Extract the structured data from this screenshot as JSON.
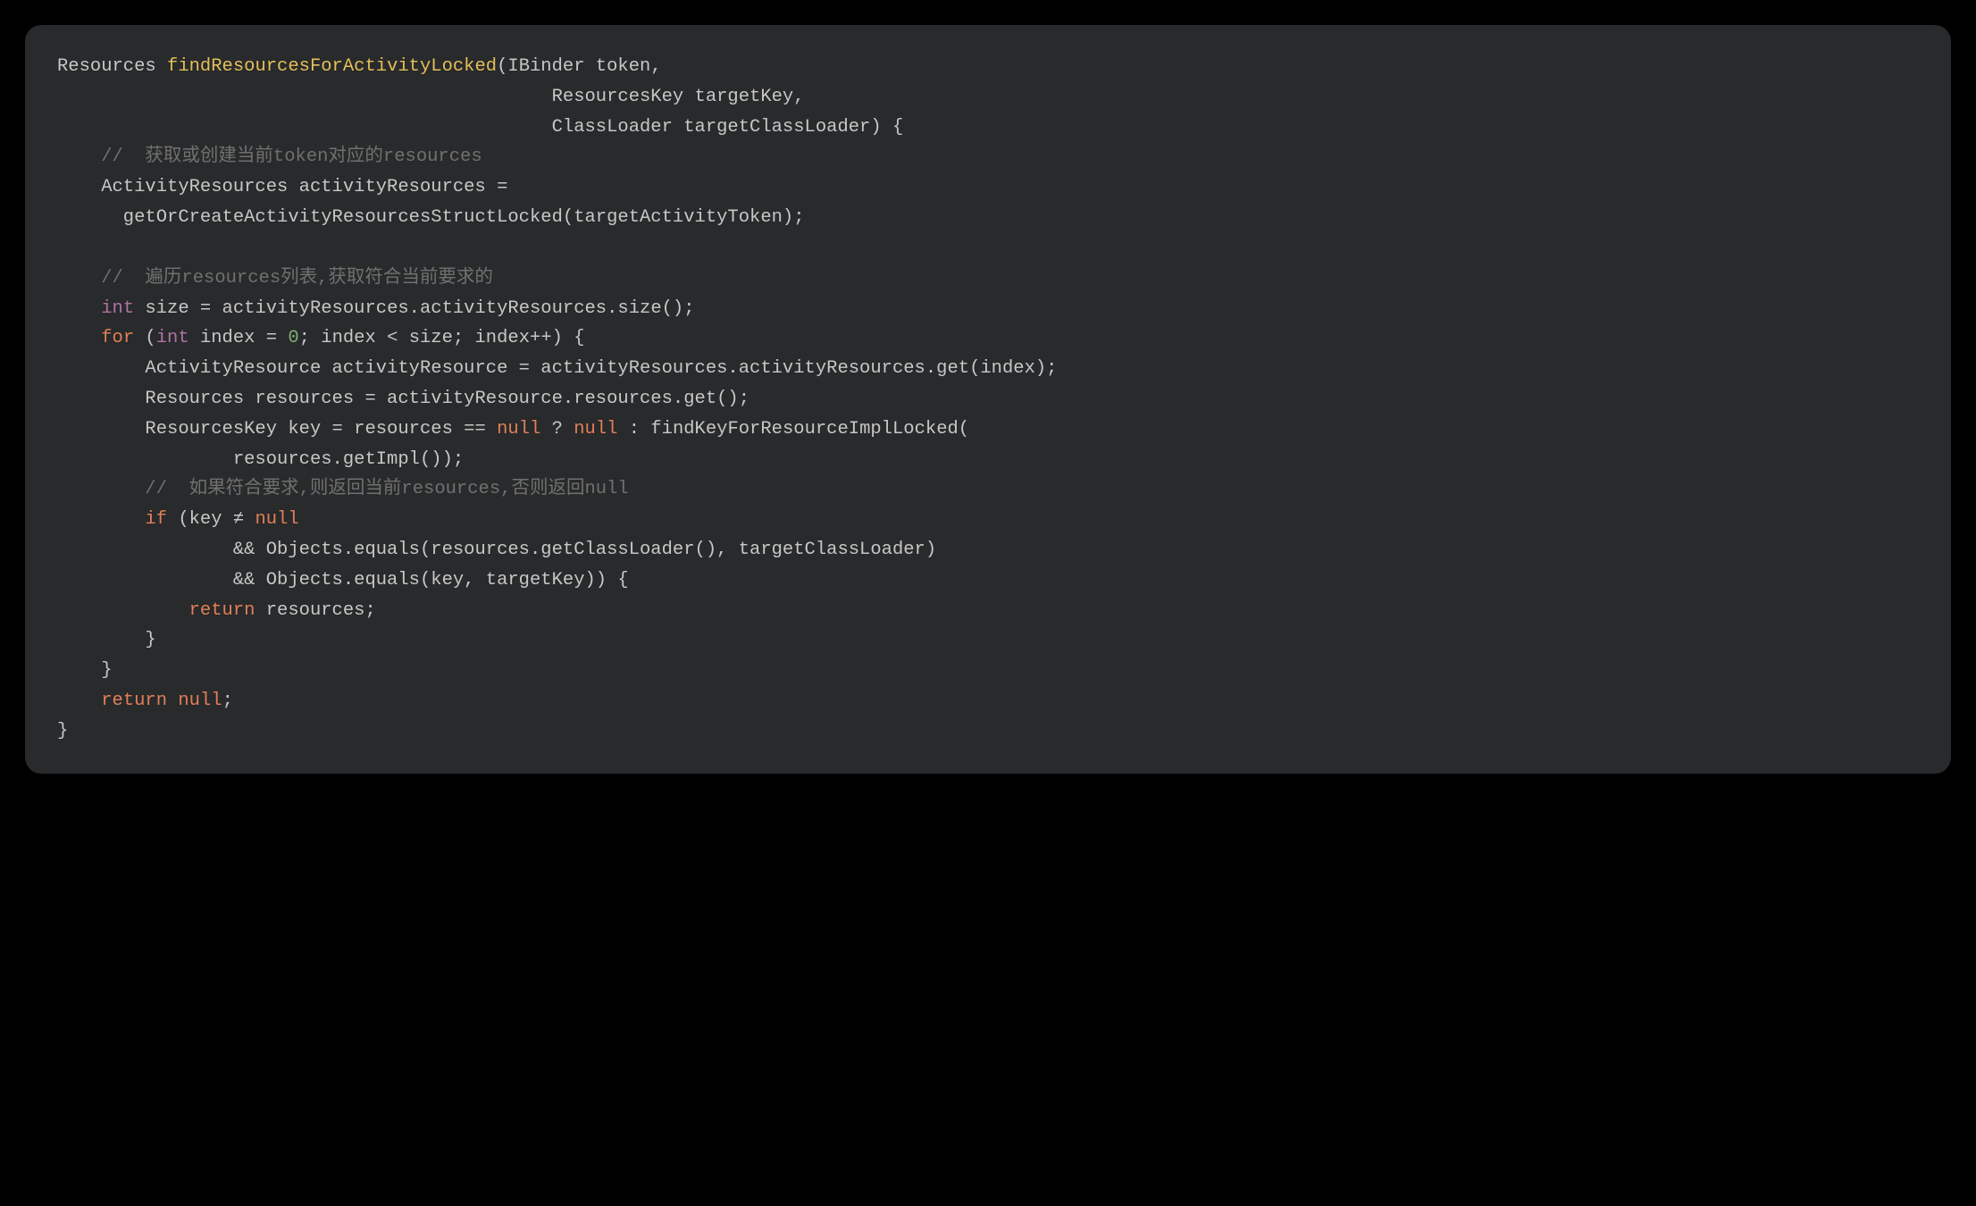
{
  "code": {
    "lines": [
      {
        "idx": 0,
        "tokens": [
          {
            "c": "tok-type",
            "t": "Resources "
          },
          {
            "c": "tok-fn",
            "t": "findResourcesForActivityLocked"
          },
          {
            "c": "tok-punct",
            "t": "(IBinder token,"
          }
        ]
      },
      {
        "idx": 1,
        "tokens": [
          {
            "c": "tok-punct",
            "t": "                                             ResourcesKey targetKey,"
          }
        ]
      },
      {
        "idx": 2,
        "tokens": [
          {
            "c": "tok-punct",
            "t": "                                             ClassLoader targetClassLoader) {"
          }
        ]
      },
      {
        "idx": 3,
        "tokens": [
          {
            "c": "tok-comment",
            "t": "    //  获取或创建当前token对应的resources"
          }
        ]
      },
      {
        "idx": 4,
        "tokens": [
          {
            "c": "tok-punct",
            "t": "    ActivityResources activityResources ="
          }
        ]
      },
      {
        "idx": 5,
        "tokens": [
          {
            "c": "tok-punct",
            "t": "      getOrCreateActivityResourcesStructLocked(targetActivityToken);"
          }
        ]
      },
      {
        "idx": 6,
        "tokens": [
          {
            "c": "tok-punct",
            "t": ""
          }
        ]
      },
      {
        "idx": 7,
        "tokens": [
          {
            "c": "tok-comment",
            "t": "    //  遍历resources列表,获取符合当前要求的"
          }
        ]
      },
      {
        "idx": 8,
        "tokens": [
          {
            "c": "tok-punct",
            "t": "    "
          },
          {
            "c": "tok-kw2",
            "t": "int"
          },
          {
            "c": "tok-punct",
            "t": " size = activityResources.activityResources.size();"
          }
        ]
      },
      {
        "idx": 9,
        "tokens": [
          {
            "c": "tok-punct",
            "t": "    "
          },
          {
            "c": "tok-kw",
            "t": "for"
          },
          {
            "c": "tok-punct",
            "t": " ("
          },
          {
            "c": "tok-kw2",
            "t": "int"
          },
          {
            "c": "tok-punct",
            "t": " index = "
          },
          {
            "c": "tok-num",
            "t": "0"
          },
          {
            "c": "tok-punct",
            "t": "; index < size; index++) {"
          }
        ]
      },
      {
        "idx": 10,
        "tokens": [
          {
            "c": "tok-punct",
            "t": "        ActivityResource activityResource = activityResources.activityResources.get(index);"
          }
        ]
      },
      {
        "idx": 11,
        "tokens": [
          {
            "c": "tok-punct",
            "t": "        Resources resources = activityResource.resources.get();"
          }
        ]
      },
      {
        "idx": 12,
        "tokens": [
          {
            "c": "tok-punct",
            "t": "        ResourcesKey key = resources == "
          },
          {
            "c": "tok-kw",
            "t": "null"
          },
          {
            "c": "tok-punct",
            "t": " ? "
          },
          {
            "c": "tok-kw",
            "t": "null"
          },
          {
            "c": "tok-punct",
            "t": " : findKeyForResourceImplLocked("
          }
        ]
      },
      {
        "idx": 13,
        "tokens": [
          {
            "c": "tok-punct",
            "t": "                resources.getImpl());"
          }
        ]
      },
      {
        "idx": 14,
        "tokens": [
          {
            "c": "tok-comment",
            "t": "        //  如果符合要求,则返回当前resources,否则返回null"
          }
        ]
      },
      {
        "idx": 15,
        "tokens": [
          {
            "c": "tok-punct",
            "t": "        "
          },
          {
            "c": "tok-kw",
            "t": "if"
          },
          {
            "c": "tok-punct",
            "t": " (key ≠ "
          },
          {
            "c": "tok-kw",
            "t": "null"
          }
        ]
      },
      {
        "idx": 16,
        "tokens": [
          {
            "c": "tok-punct",
            "t": "                && Objects.equals(resources.getClassLoader(), targetClassLoader)"
          }
        ]
      },
      {
        "idx": 17,
        "tokens": [
          {
            "c": "tok-punct",
            "t": "                && Objects.equals(key, targetKey)) {"
          }
        ]
      },
      {
        "idx": 18,
        "tokens": [
          {
            "c": "tok-punct",
            "t": "            "
          },
          {
            "c": "tok-kw",
            "t": "return"
          },
          {
            "c": "tok-punct",
            "t": " resources;"
          }
        ]
      },
      {
        "idx": 19,
        "tokens": [
          {
            "c": "tok-punct",
            "t": "        }"
          }
        ]
      },
      {
        "idx": 20,
        "tokens": [
          {
            "c": "tok-punct",
            "t": "    }"
          }
        ]
      },
      {
        "idx": 21,
        "tokens": [
          {
            "c": "tok-punct",
            "t": "    "
          },
          {
            "c": "tok-kw",
            "t": "return"
          },
          {
            "c": "tok-punct",
            "t": " "
          },
          {
            "c": "tok-kw",
            "t": "null"
          },
          {
            "c": "tok-punct",
            "t": ";"
          }
        ]
      },
      {
        "idx": 22,
        "tokens": [
          {
            "c": "tok-punct",
            "t": "}"
          }
        ]
      }
    ]
  }
}
